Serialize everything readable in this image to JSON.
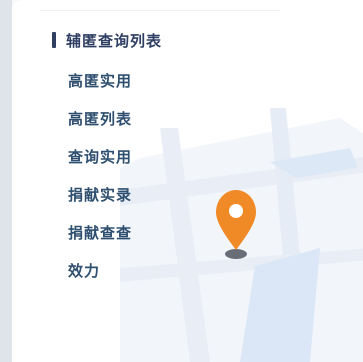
{
  "menu_section": {
    "title": "辅匿查询列表",
    "items": [
      {
        "label": "高匿实用"
      },
      {
        "label": "高匿列表"
      },
      {
        "label": "查询实用"
      },
      {
        "label": "捐献实录"
      },
      {
        "label": "捐献查查"
      },
      {
        "label": "效力"
      }
    ]
  },
  "map_illustration": {
    "pin_icon": "location-pin-icon",
    "pin_color": "#f08a26",
    "road_color": "#e3ebf6",
    "water_color": "#e2edf9"
  }
}
